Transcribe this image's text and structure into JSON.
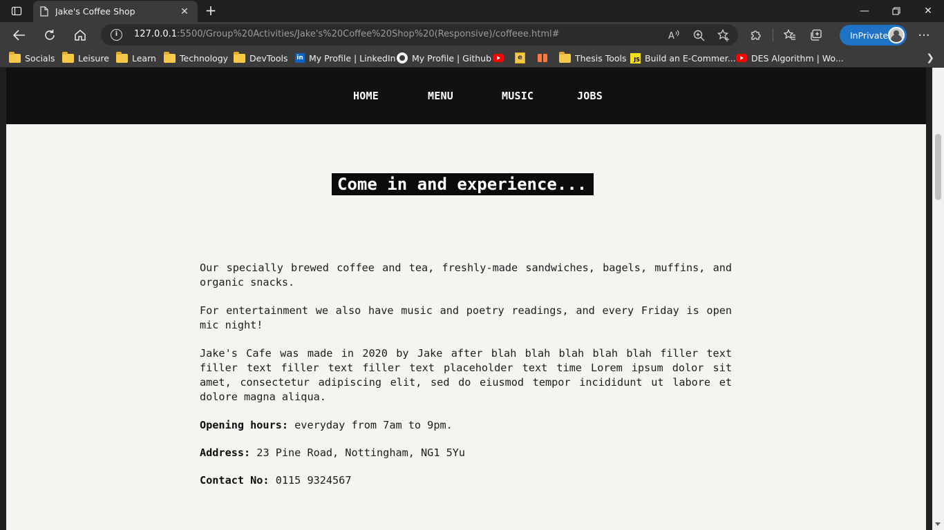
{
  "browser": {
    "tab_title": "Jake's Coffee Shop",
    "url_host": "127.0.0.1",
    "url_rest": ":5500/Group%20Activities/Jake's%20Coffee%20Shop%20(Responsive)/coffeee.html#",
    "inprivate_label": "InPrivate",
    "bookmarks": [
      {
        "label": "Socials",
        "icon": "folder-icon"
      },
      {
        "label": "Leisure",
        "icon": "folder-icon"
      },
      {
        "label": "Learn",
        "icon": "folder-icon"
      },
      {
        "label": "Technology",
        "icon": "folder-icon"
      },
      {
        "label": "DevTools",
        "icon": "folder-icon"
      },
      {
        "label": "My Profile | LinkedIn",
        "icon": "linkedin-icon"
      },
      {
        "label": "My Profile | Github",
        "icon": "github-icon"
      },
      {
        "label": "",
        "icon": "youtube-icon"
      },
      {
        "label": "",
        "icon": "e-icon"
      },
      {
        "label": "",
        "icon": "gift-icon"
      },
      {
        "label": "Thesis Tools",
        "icon": "folder-icon"
      },
      {
        "label": "Build an E-Commer...",
        "icon": "js-icon"
      },
      {
        "label": "DES Algorithm | Wo...",
        "icon": "youtube-icon"
      }
    ]
  },
  "site": {
    "nav": [
      "HOME",
      "MENU",
      "MUSIC",
      "JOBS"
    ],
    "headline": "Come in and experience...",
    "paragraphs": [
      "Our specially brewed coffee and tea, freshly-made sandwiches, bagels, muffins, and organic snacks.",
      "For entertainment we also have music and poetry readings, and every Friday is open mic night!",
      "Jake's Cafe was made in 2020 by Jake after blah blah blah blah blah filler text filler text filler text filler text placeholder text time Lorem ipsum dolor sit amet, consectetur adipiscing elit, sed do eiusmod tempor incididunt ut labore et dolore magna aliqua."
    ],
    "hours_label": "Opening hours:",
    "hours_value": " everyday from 7am to 9pm.",
    "address_label": "Address:",
    "address_value": " 23 Pine Road, Nottingham, NG1 5Yu",
    "contact_label": "Contact No:",
    "contact_value": " 0115 9324567"
  },
  "colors": {
    "nav_bg": "#111111",
    "page_bg": "#f5f4f1",
    "inprivate_bg": "#1f73c7"
  }
}
